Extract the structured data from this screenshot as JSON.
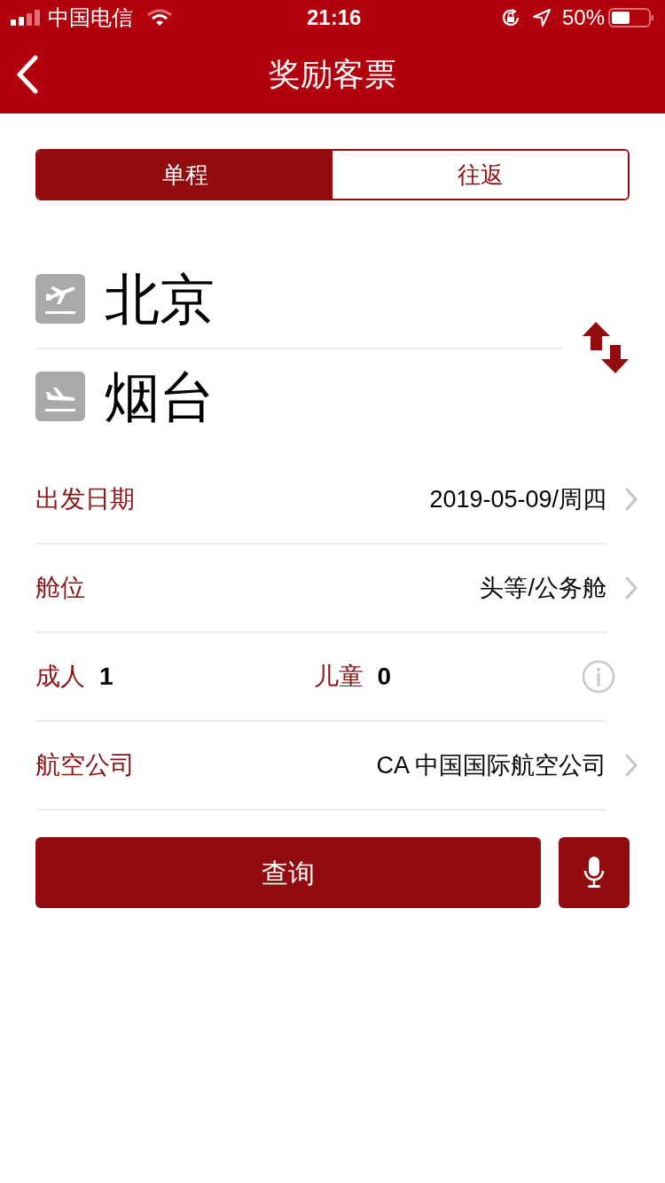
{
  "status_bar": {
    "carrier": "中国电信",
    "time": "21:16",
    "battery": "50%"
  },
  "nav": {
    "title": "奖励客票"
  },
  "tabs": [
    {
      "label": "单程",
      "selected": true
    },
    {
      "label": "往返",
      "selected": false
    }
  ],
  "route": {
    "from": "北京",
    "to": "烟台"
  },
  "rows": [
    {
      "kind": "select",
      "label": "出发日期",
      "value": "2019-05-09/周四"
    },
    {
      "kind": "select",
      "label": "舱位",
      "value": "头等/公务舱"
    },
    {
      "kind": "passengers",
      "adult_label": "成人",
      "adults": "1",
      "child_label": "儿童",
      "children": "0"
    },
    {
      "kind": "select",
      "label": "航空公司",
      "value": "CA 中国国际航空公司"
    }
  ],
  "search_button": "查询"
}
